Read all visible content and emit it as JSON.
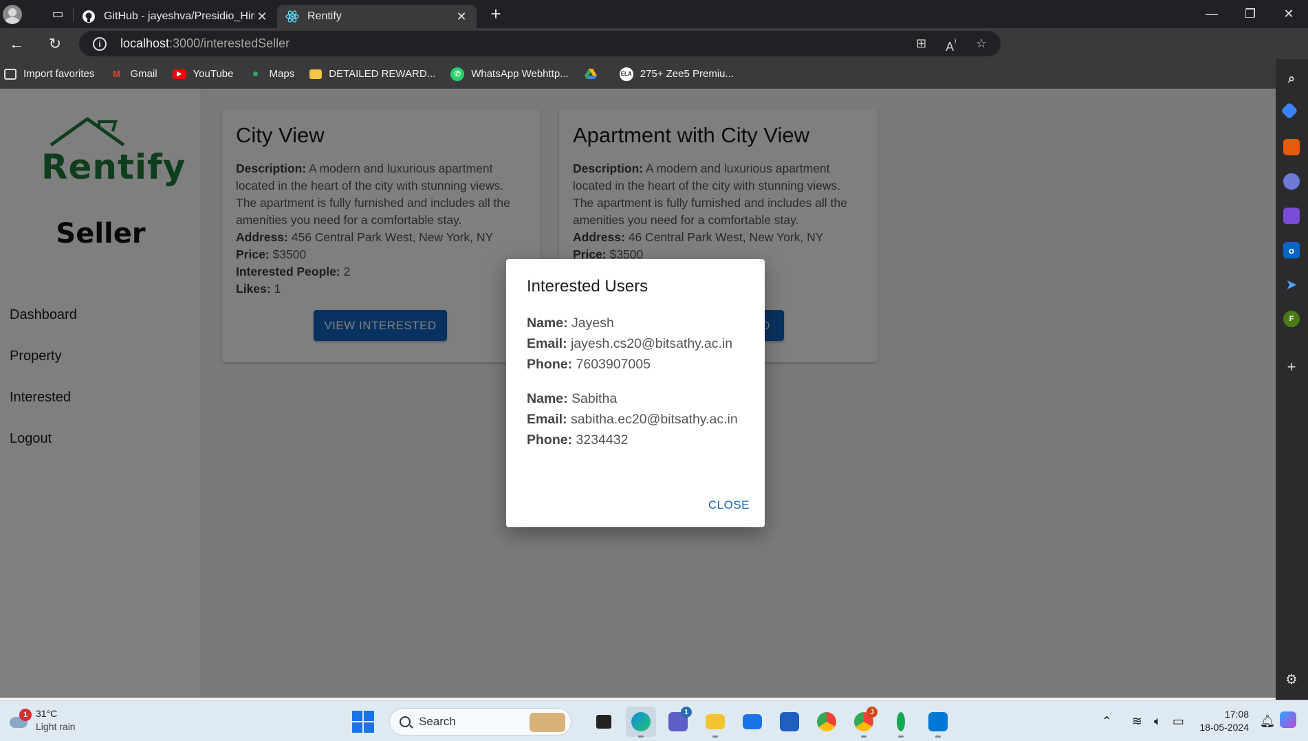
{
  "browser": {
    "tabs": [
      {
        "title": "GitHub - jayeshva/Presidio_Hiring",
        "icon": "github-icon",
        "active": false
      },
      {
        "title": "Rentify",
        "icon": "react-icon",
        "active": true
      }
    ],
    "address": {
      "host": "localhost",
      "path": ":3000/interestedSeller"
    },
    "bookmarks": [
      {
        "label": "Import favorites",
        "icon": "import-icon"
      },
      {
        "label": "Gmail",
        "icon": "gmail-icon"
      },
      {
        "label": "YouTube",
        "icon": "youtube-icon"
      },
      {
        "label": "Maps",
        "icon": "maps-icon"
      },
      {
        "label": "DETAILED REWARD...",
        "icon": "folder-icon"
      },
      {
        "label": "WhatsApp Webhttp...",
        "icon": "whatsapp-icon"
      },
      {
        "label": "",
        "icon": "drive-icon"
      },
      {
        "label": "275+ Zee5 Premiu...",
        "icon": "zee5-icon"
      }
    ]
  },
  "app": {
    "logo_text": "Rentify",
    "role_title": "Seller",
    "nav": [
      "Dashboard",
      "Property",
      "Interested",
      "Logout"
    ],
    "labels": {
      "description": "Description:",
      "address": "Address:",
      "price": "Price:",
      "interested": "Interested People:",
      "likes": "Likes:"
    },
    "cards": [
      {
        "title": "City View",
        "description": "A modern and luxurious apartment located in the heart of the city with stunning views. The apartment is fully furnished and includes all the amenities you need for a comfortable stay.",
        "address": "456 Central Park West, New York, NY",
        "price": "$3500",
        "interested": "2",
        "likes": "1",
        "button": "VIEW INTERESTED"
      },
      {
        "title": "Apartment with City View",
        "description": "A modern and luxurious apartment located in the heart of the city with stunning views. The apartment is fully furnished and includes all the amenities you need for a comfortable stay.",
        "address": "46 Central Park West, New York, NY",
        "price": "$3500",
        "button_visible_fragment": "D"
      }
    ]
  },
  "dialog": {
    "title": "Interested Users",
    "labels": {
      "name": "Name:",
      "email": "Email:",
      "phone": "Phone:"
    },
    "users": [
      {
        "name": "Jayesh",
        "email": "jayesh.cs20@bitsathy.ac.in",
        "phone": "7603907005"
      },
      {
        "name": "Sabitha",
        "email": "sabitha.ec20@bitsathy.ac.in",
        "phone": "3234432"
      }
    ],
    "close_label": "CLOSE"
  },
  "taskbar": {
    "weather": {
      "temp": "31°C",
      "desc": "Light rain",
      "badge": "1"
    },
    "search_placeholder": "Search",
    "time": "17:08",
    "date": "18-05-2024"
  },
  "colors": {
    "brand_green": "#1f7a3a",
    "primary": "#1565c0"
  }
}
